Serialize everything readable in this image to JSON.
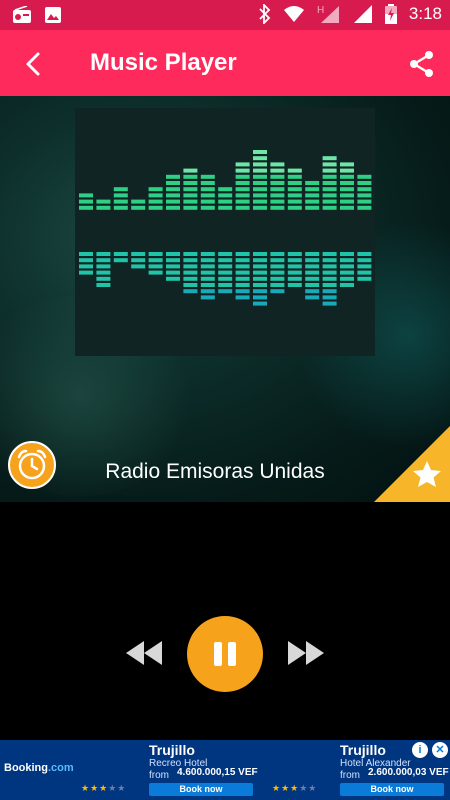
{
  "status_bar": {
    "time": "3:18",
    "icons": [
      "radio-icon",
      "image-icon",
      "bluetooth-icon",
      "wifi-icon",
      "network-h-icon",
      "signal-icon",
      "battery-charging-icon"
    ]
  },
  "app_bar": {
    "title": "Music Player",
    "back_icon": "arrow-back-icon",
    "share_icon": "share-icon"
  },
  "player": {
    "station_name": "Radio Emisoras Unidas",
    "timer_icon": "alarm-clock-icon",
    "favorite_icon": "star-icon",
    "controls": {
      "rewind_icon": "rewind-icon",
      "pause_icon": "pause-icon",
      "fast_forward_icon": "fast-forward-icon"
    }
  },
  "ad": {
    "brand": "Booking",
    "brand_suffix": ".com",
    "cards": [
      {
        "city": "Trujillo",
        "hotel": "Recreo Hotel",
        "from": "from",
        "price": "4.600.000,15 VEF",
        "button": "Book now",
        "stars": 3
      },
      {
        "city": "Trujillo",
        "hotel": "Hotel Alexander",
        "from": "from",
        "price": "2.600.000,03 VEF",
        "button": "Book now",
        "stars": 3
      }
    ]
  },
  "colors": {
    "status_bar": "#d81b4f",
    "app_bar": "#ff2a5c",
    "accent": "#f7a21b",
    "ad_background": "#003580"
  }
}
